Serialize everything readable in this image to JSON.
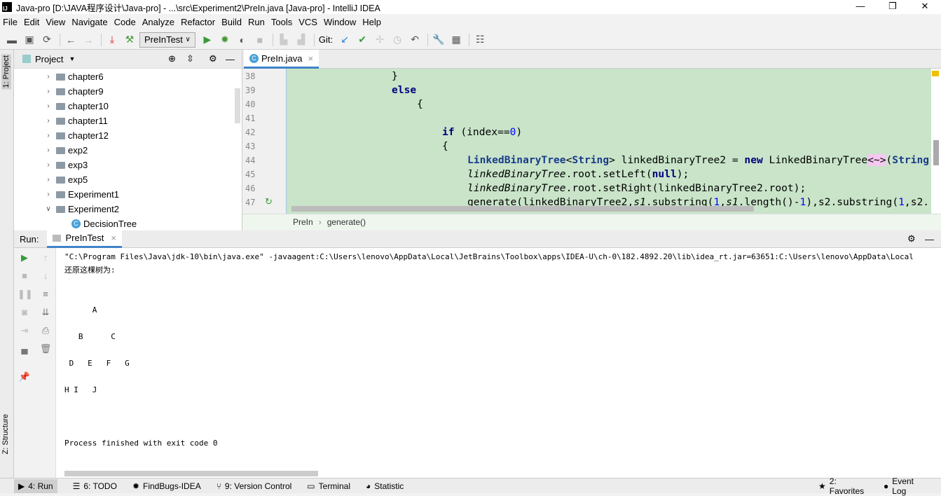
{
  "window": {
    "title": "Java-pro [D:\\JAVA程序设计\\Java-pro] - ...\\src\\Experiment2\\PreIn.java [Java-pro] - IntelliJ IDEA",
    "logo": "IJ"
  },
  "menu": [
    "File",
    "Edit",
    "View",
    "Navigate",
    "Code",
    "Analyze",
    "Refactor",
    "Build",
    "Run",
    "Tools",
    "VCS",
    "Window",
    "Help"
  ],
  "toolbar": {
    "run_config": "PreInTest",
    "git_label": "Git:"
  },
  "left_strip": {
    "project": "1: Project",
    "structure": "Z: Structure"
  },
  "project": {
    "title": "Project",
    "items": [
      {
        "label": "chapter6",
        "type": "folder",
        "expanded": false
      },
      {
        "label": "chapter9",
        "type": "folder",
        "expanded": false
      },
      {
        "label": "chapter10",
        "type": "folder",
        "expanded": false
      },
      {
        "label": "chapter11",
        "type": "folder",
        "expanded": false
      },
      {
        "label": "chapter12",
        "type": "folder",
        "expanded": false
      },
      {
        "label": "exp2",
        "type": "folder",
        "expanded": false
      },
      {
        "label": "exp3",
        "type": "folder",
        "expanded": false
      },
      {
        "label": "exp5",
        "type": "folder",
        "expanded": false
      },
      {
        "label": "Experiment1",
        "type": "folder",
        "expanded": false
      },
      {
        "label": "Experiment2",
        "type": "folder",
        "expanded": true
      },
      {
        "label": "DecisionTree",
        "type": "class",
        "expanded": false
      }
    ]
  },
  "editor": {
    "tab": "PreIn.java",
    "line_numbers": [
      "38",
      "39",
      "40",
      "41",
      "42",
      "43",
      "44",
      "45",
      "46",
      "47"
    ],
    "breadcrumb": [
      "PreIn",
      "generate()"
    ]
  },
  "run": {
    "label": "Run:",
    "tab": "PreInTest",
    "console": "\"C:\\Program Files\\Java\\jdk-10\\bin\\java.exe\" -javaagent:C:\\Users\\lenovo\\AppData\\Local\\JetBrains\\Toolbox\\apps\\IDEA-U\\ch-0\\182.4892.20\\lib\\idea_rt.jar=63651:C:\\Users\\lenovo\\AppData\\Local\n还原这棵树为:\n\n\n      A\n\n   B      C\n\n D   E   F   G\n\nH I   J\n\n\n\nProcess finished with exit code 0"
  },
  "bottom": [
    {
      "label": "4: Run",
      "icon": "run-icon"
    },
    {
      "label": "6: TODO",
      "icon": "todo-icon"
    },
    {
      "label": "FindBugs-IDEA",
      "icon": "bug-icon"
    },
    {
      "label": "9: Version Control",
      "icon": "vcs-icon"
    },
    {
      "label": "Terminal",
      "icon": "terminal-icon"
    },
    {
      "label": "Statistic",
      "icon": "statistic-icon"
    }
  ],
  "bottom_right": [
    {
      "label": "2: Favorites",
      "icon": "star-icon"
    },
    {
      "label": "Event Log",
      "icon": "event-log-icon"
    }
  ]
}
